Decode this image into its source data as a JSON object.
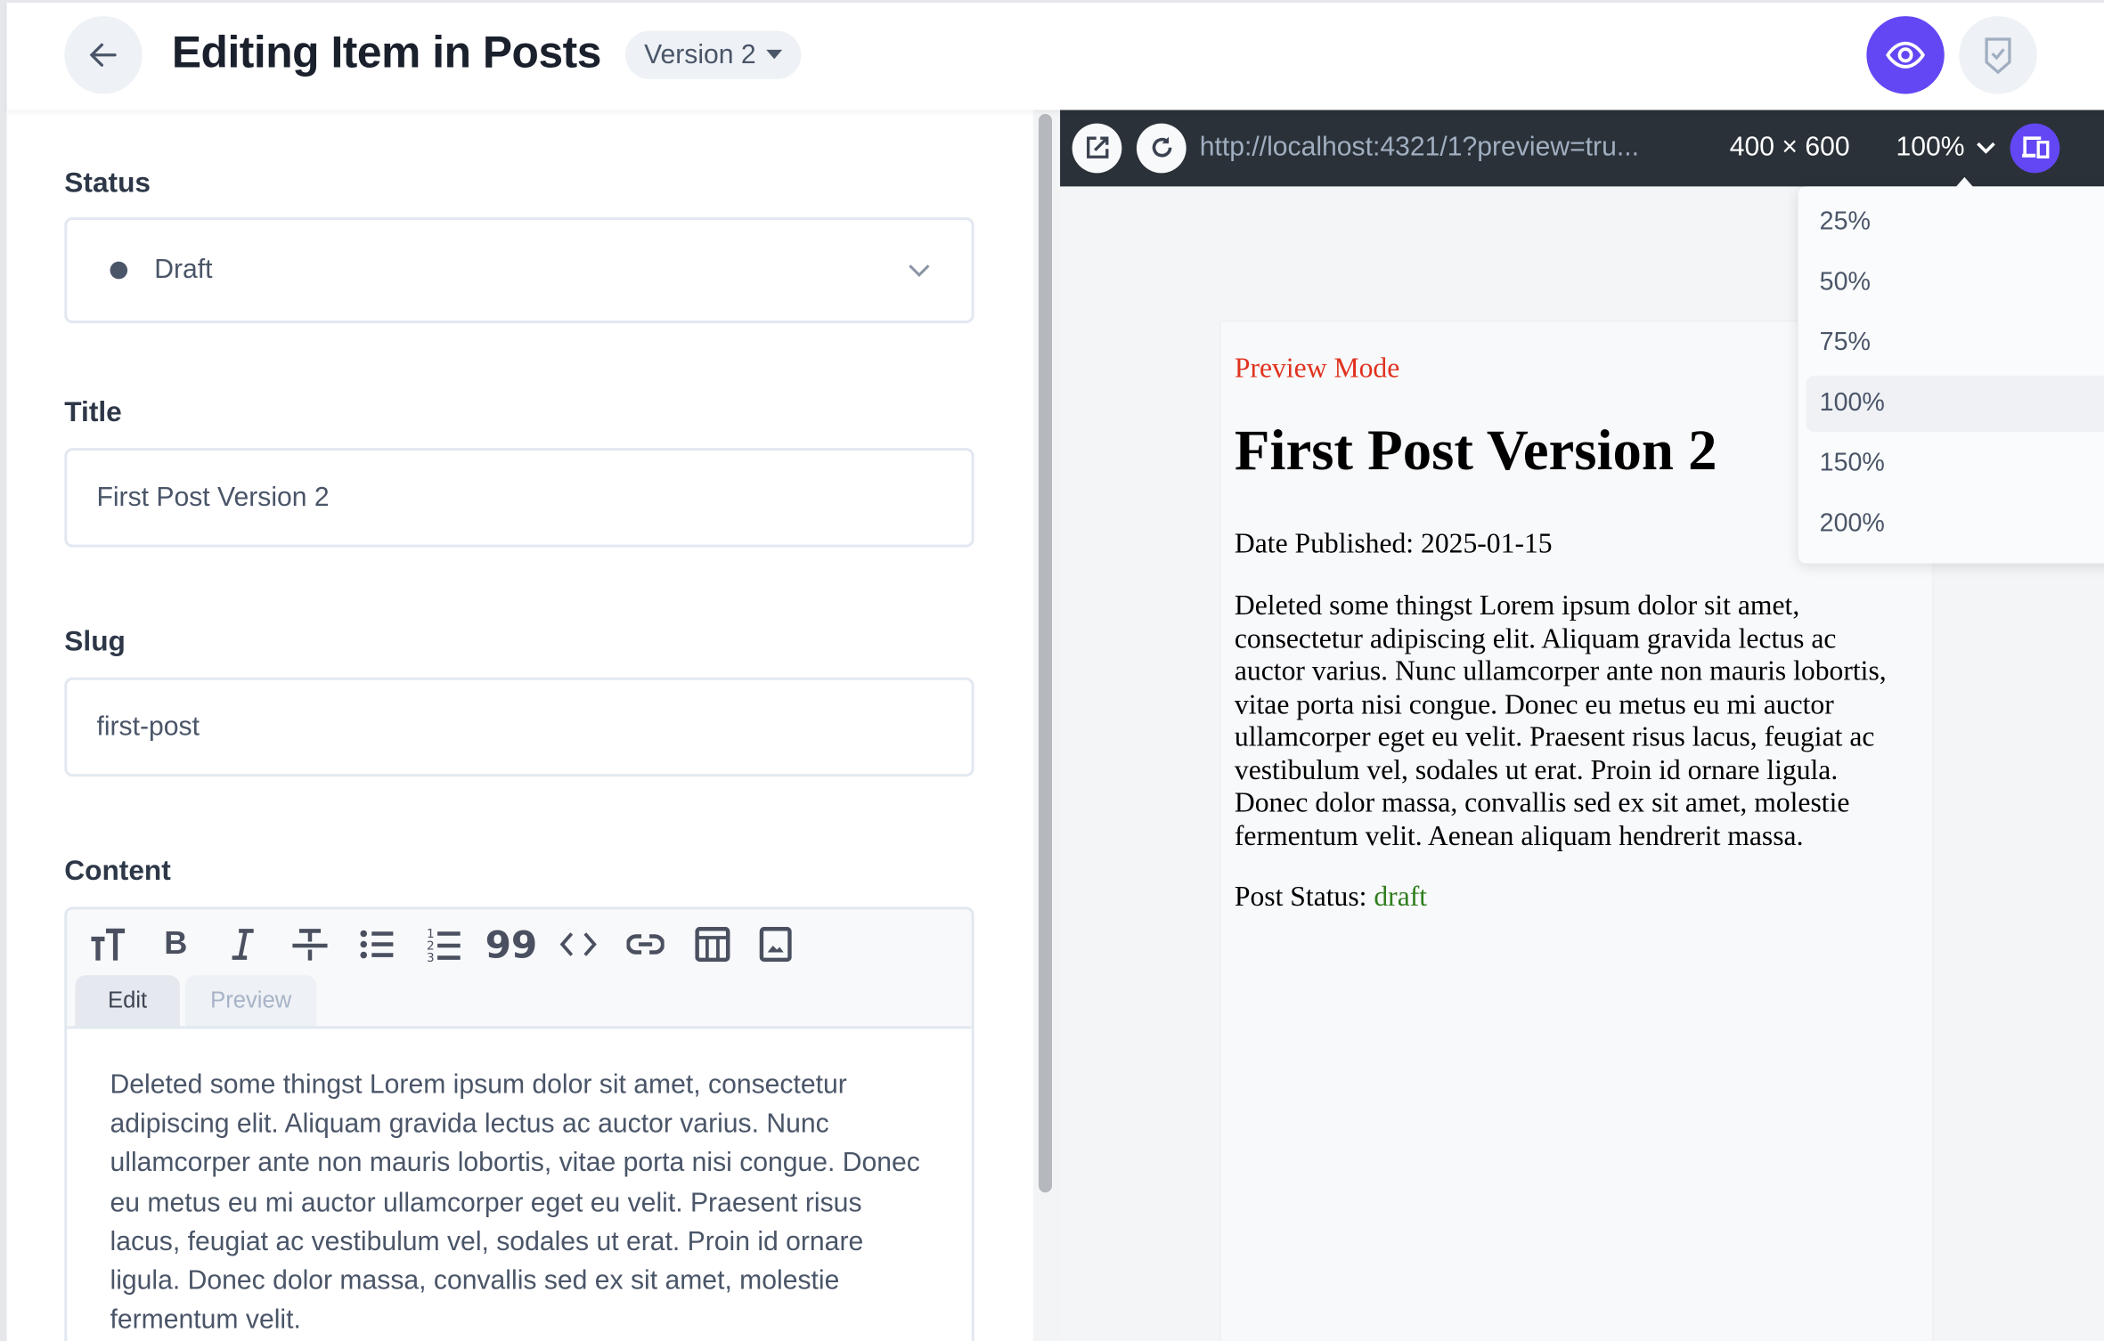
{
  "header": {
    "title": "Editing Item in Posts",
    "version": "Version 2"
  },
  "form": {
    "status": {
      "label": "Status",
      "value": "Draft"
    },
    "title": {
      "label": "Title",
      "value": "First Post Version 2"
    },
    "slug": {
      "label": "Slug",
      "value": "first-post"
    },
    "content": {
      "label": "Content",
      "tabs": [
        "Edit",
        "Preview"
      ],
      "active_tab": "Edit",
      "toolbar": [
        "heading-icon",
        "bold-icon",
        "italic-icon",
        "strikethrough-icon",
        "bullet-list-icon",
        "numbered-list-icon",
        "quote-icon",
        "code-icon",
        "link-icon",
        "table-icon",
        "image-icon"
      ],
      "text": "Deleted some thingst Lorem ipsum dolor sit amet, consectetur adipiscing elit. Aliquam gravida lectus ac auctor varius. Nunc ullamcorper ante non mauris lobortis, vitae porta nisi congue. Donec eu metus eu mi auctor ullamcorper eget eu velit. Praesent risus lacus, feugiat ac vestibulum vel, sodales ut erat. Proin id ornare ligula. Donec dolor massa, convallis sed ex sit amet, molestie fermentum velit."
    }
  },
  "preview_bar": {
    "url": "http://localhost:4321/1?preview=tru...",
    "dimensions": "400 × 600",
    "zoom": "100%"
  },
  "zoom_options": [
    "25%",
    "50%",
    "75%",
    "100%",
    "150%",
    "200%"
  ],
  "preview": {
    "mode": "Preview Mode",
    "heading": "First Post Version 2",
    "date": "Date Published: 2025-01-15",
    "body": "Deleted some thingst Lorem ipsum dolor sit amet, consectetur adipiscing elit. Aliquam gravida lectus ac auctor varius. Nunc ullamcorper ante non mauris lobortis, vitae porta nisi congue. Donec eu metus eu mi auctor ullamcorper eget eu velit. Praesent risus lacus, feugiat ac vestibulum vel, sodales ut erat. Proin id ornare ligula. Donec dolor massa, convallis sed ex sit amet, molestie fermentum velit. Aenean aliquam hendrerit massa.",
    "status_label": "Post Status:",
    "status_value": "draft"
  },
  "colors": {
    "accent": "#6347f5",
    "preview_mode": "#e0321f",
    "status_value": "#2e7d1c",
    "toolbar_bg": "#2a3138"
  }
}
